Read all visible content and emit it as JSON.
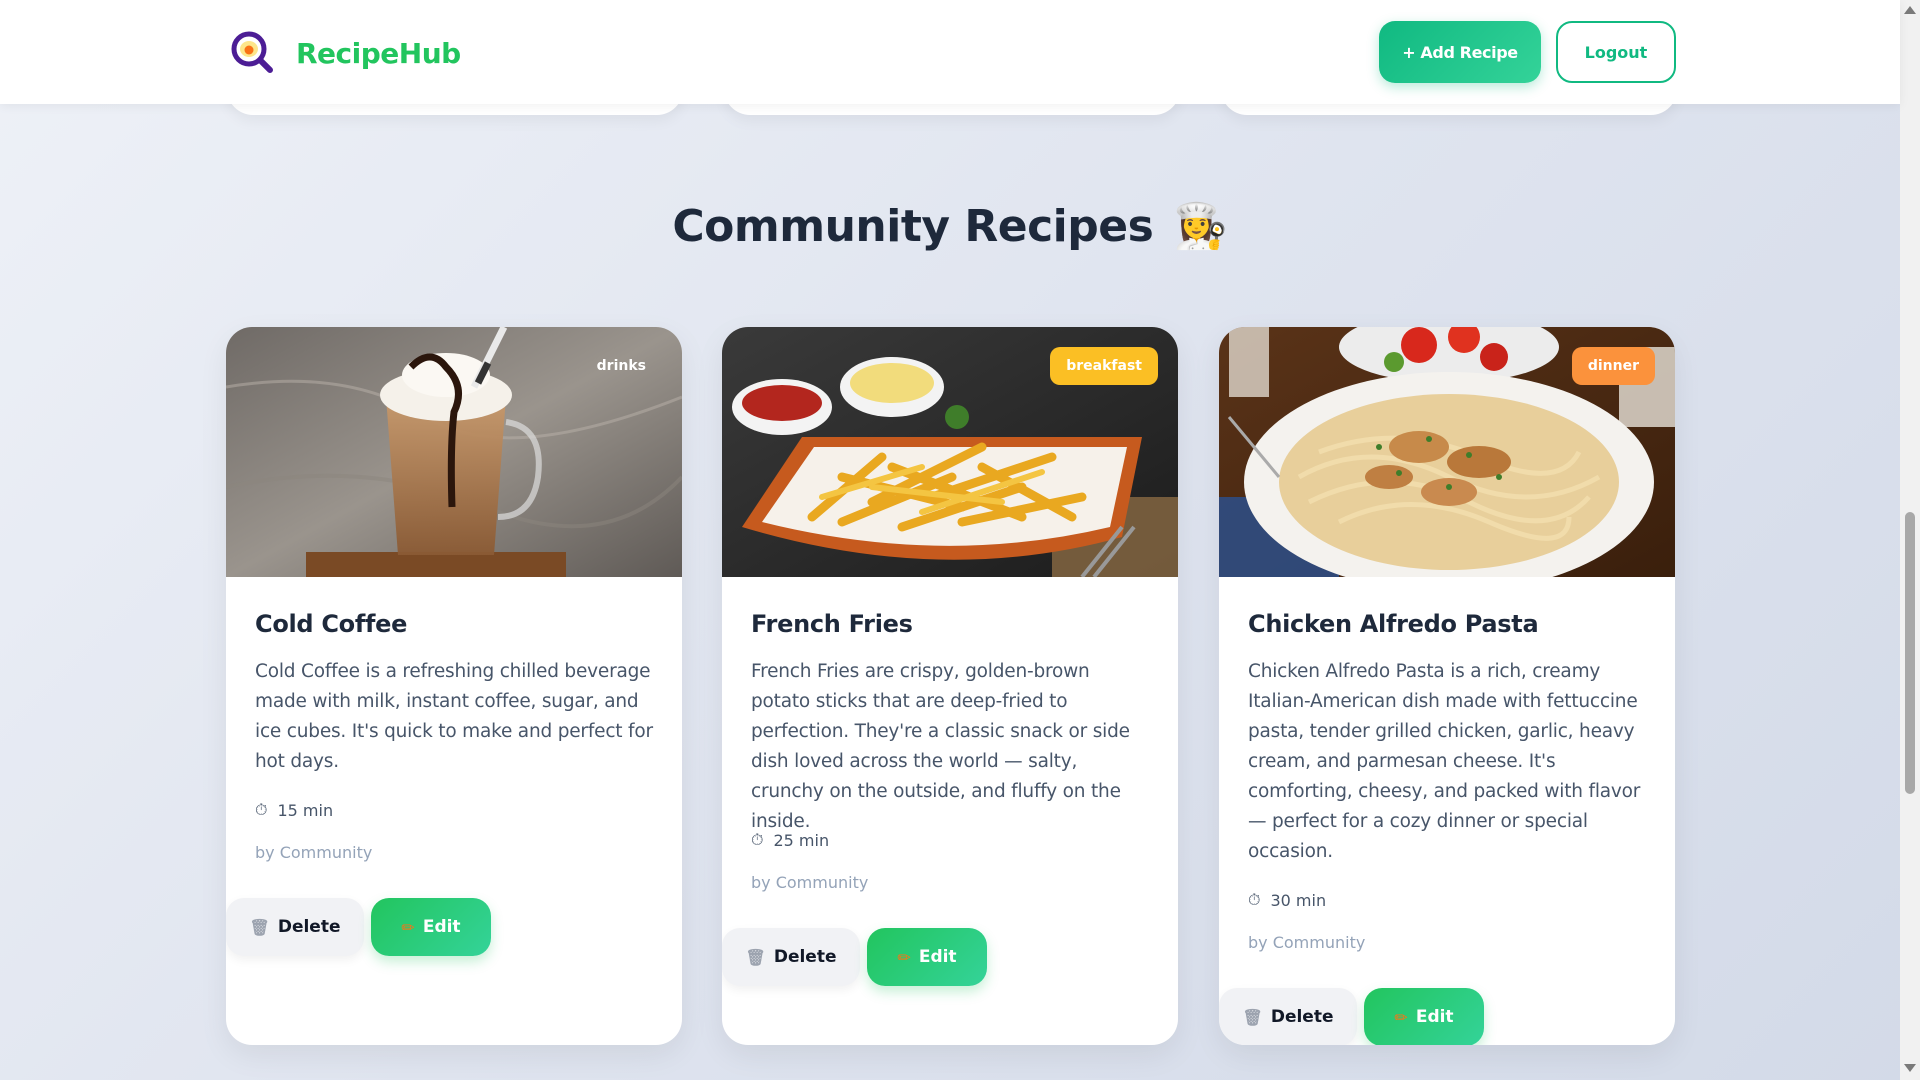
{
  "app": {
    "name": "RecipeHub",
    "logo_icon": "magnifier-egg-icon"
  },
  "header": {
    "add_recipe_label": "+ Add Recipe",
    "logout_label": "Logout"
  },
  "section": {
    "title": "Community Recipes",
    "title_emoji": "👩‍🍳"
  },
  "recipes": [
    {
      "title": "Cold Coffee",
      "category": "drinks",
      "category_color": "transparent",
      "description": "Cold Coffee is a refreshing chilled beverage made with milk, instant coffee, sugar, and ice cubes. It's quick to make and perfect for hot days.",
      "time": "15 min",
      "author": "by Community",
      "delete_label": "Delete",
      "edit_label": "Edit"
    },
    {
      "title": "French Fries",
      "category": "breakfast",
      "category_color": "#fbbf24",
      "description": "French Fries are crispy, golden-brown potato sticks that are deep-fried to perfection. They're a classic snack or side dish loved across the world — salty, crunchy on the outside, and fluffy on the inside.",
      "time": "25 min",
      "author": "by Community",
      "delete_label": "Delete",
      "edit_label": "Edit"
    },
    {
      "title": "Chicken Alfredo Pasta",
      "category": "dinner",
      "category_color": "#fb923c",
      "description": "Chicken Alfredo Pasta is a rich, creamy Italian-American dish made with fettuccine pasta, tender grilled chicken, garlic, heavy cream, and parmesan cheese. It's comforting, cheesy, and packed with flavor — perfect for a cozy dinner or special occasion.",
      "time": "30 min",
      "author": "by Community",
      "delete_label": "Delete",
      "edit_label": "Edit"
    }
  ],
  "icons": {
    "timer": "⏱",
    "delete": "🗑",
    "edit": "✏"
  },
  "colors": {
    "brand": "#22c55e",
    "accent": "#10b981",
    "text_dark": "#1e293b"
  }
}
